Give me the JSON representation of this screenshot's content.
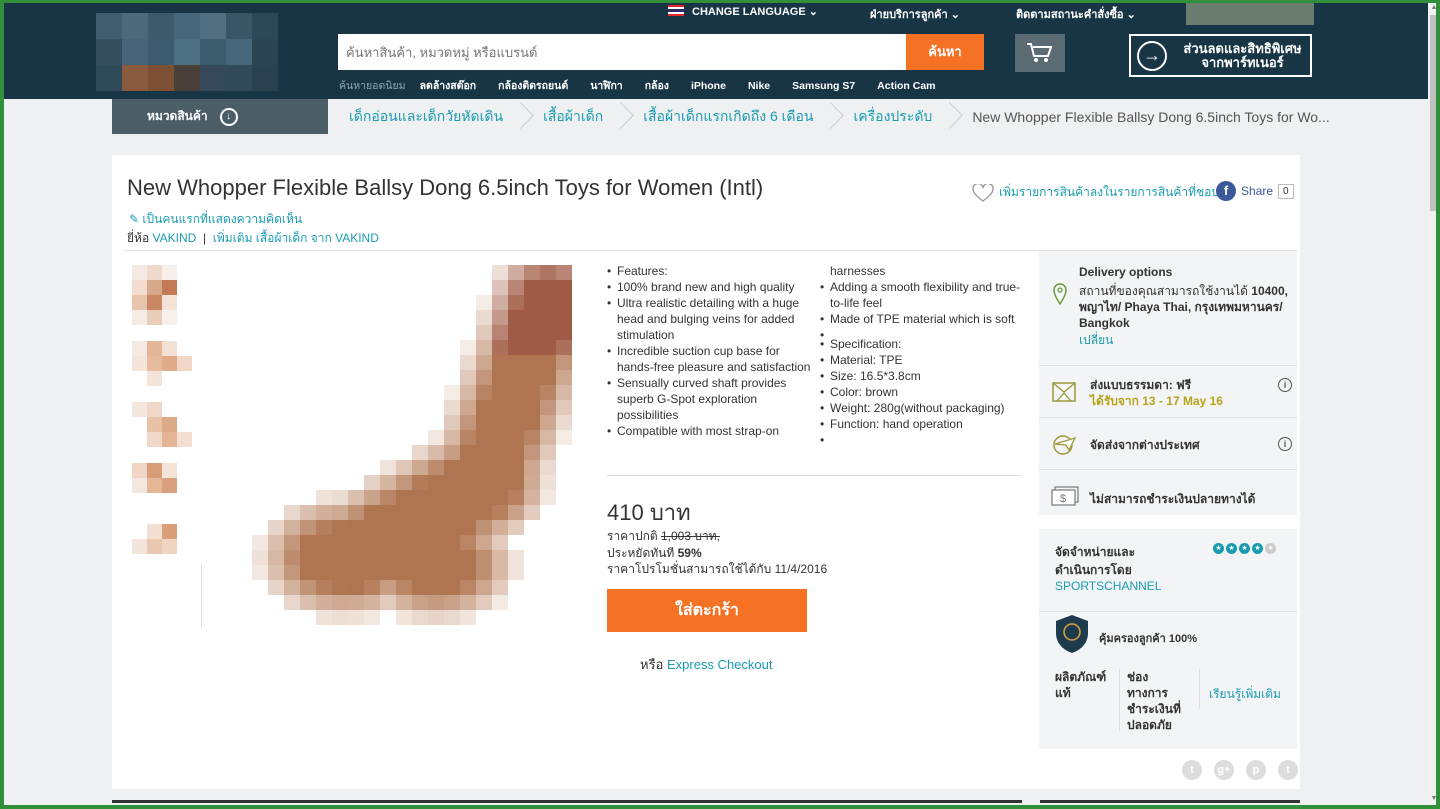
{
  "header": {
    "change_language": "CHANGE LANGUAGE",
    "customer_service": "ฝ่ายบริการลูกค้า",
    "track_order": "ติดตามสถานะคำสั่งซื้อ",
    "search_placeholder": "ค้นหาสินค้า, หมวดหมู่ หรือแบรนด์",
    "search_button": "ค้นหา",
    "partner_label": "ส่วนลดและสิทธิพิเศษ จากพาร์ทเนอร์",
    "popular_label": "ค้นหายอดนิยม",
    "popular": [
      "ลดล้างสต๊อก",
      "กล้องติดรถยนต์",
      "นาฬิกา",
      "กล้อง",
      "iPhone",
      "Nike",
      "Samsung S7",
      "Action Cam"
    ]
  },
  "nav": {
    "categories_label": "หมวดสินค้า",
    "breadcrumbs": [
      "เด็กอ่อนและเด็กวัยหัดเดิน",
      "เสื้อผ้าเด็ก",
      "เสื้อผ้าเด็กแรกเกิดถึง 6 เดือน",
      "เครื่องประดับ"
    ],
    "current": "New Whopper Flexible Ballsy Dong 6.5inch Toys for Wo..."
  },
  "product": {
    "title": "New Whopper Flexible Ballsy Dong 6.5inch Toys for Women (Intl)",
    "review_link": "เป็นคนแรกที่แสดงความคิดเห็น",
    "brand_label": "ยี่ห้อ",
    "brand": "VAKIND",
    "more_label": "เพิ่มเติม เสื้อผ้าเด็ก จาก VAKIND",
    "wishlist": "เพิ่มรายการสินค้าลงในรายการสินค้าที่ชอบ",
    "share_label": "Share",
    "share_count": "0",
    "features_left": [
      "Features:",
      "100% brand new and high quality",
      "Ultra realistic detailing with a huge head and bulging veins for added stimulation",
      "Incredible suction cup base for hands-free pleasure and satisfaction",
      "Sensually curved shaft provides superb G-Spot exploration possibilities",
      "Compatible with most strap-on"
    ],
    "features_right": [
      "harnesses",
      "Adding a smooth flexibility and true-to-life feel",
      "Made of TPE material which is soft",
      "",
      "Specification:",
      "Material: TPE",
      "Size: 16.5*3.8cm",
      "Color: brown",
      "Weight: 280g(without packaging)",
      "Function: hand operation",
      ""
    ],
    "price": "410 บาท",
    "old_price_label": "ราคาปกติ",
    "old_price": "1,003 บาท,",
    "save_label": "ประหยัดทันที",
    "save_value": "59%",
    "promo": "ราคาโปรโมชั่นสามารถใช้ได้กับ 11/4/2016",
    "buy_button": "ใส่ตะกร้า",
    "or_label": "หรือ",
    "express_checkout": "Express Checkout"
  },
  "delivery": {
    "title": "Delivery options",
    "address_prefix": "สถานที่ของคุณสามารถใช้งานได้",
    "address_bold": "10400, พญาไท/ Phaya Thai, กรุงเทพมหานคร/ Bangkok",
    "change": "เปลี่ยน",
    "standard_label": "ส่งแบบธรรมดา: ฟรี",
    "standard_date": "ได้รับจาก 13 - 17 May 16",
    "overseas": "จัดส่งจากต่างประเทศ",
    "cod": "ไม่สามารถชำระเงินปลายทางได้"
  },
  "seller": {
    "label": "จัดจำหน่ายและดำเนินการโดย",
    "name": "SPORTSCHANNEL",
    "rating": 4,
    "guarantee": "คุ้มครองลูกค้า 100%",
    "col1": "ผลิตภัณฑ์แท้",
    "col2": "ช่องทางการชำระเงินที่ปลอดภัย",
    "learn_more": "เรียนรู้เพิ่มเติม"
  },
  "social": [
    "t",
    "g+",
    "p",
    "t"
  ],
  "colors": {
    "accent": "#f57224",
    "header": "#183545",
    "link": "#1a9cb0"
  }
}
